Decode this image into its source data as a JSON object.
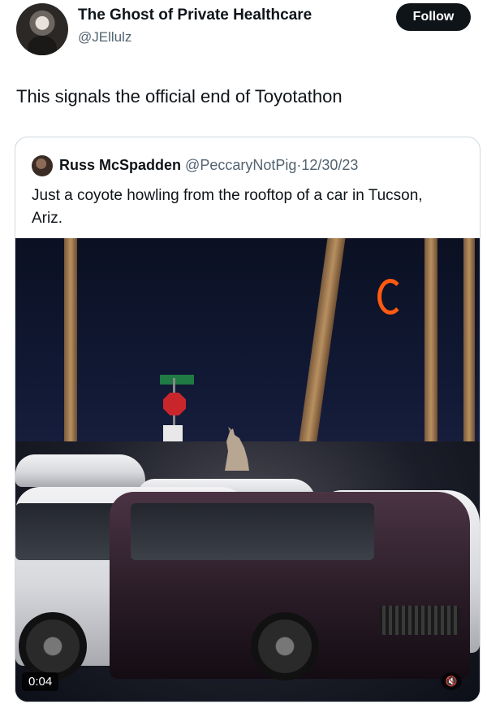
{
  "author": {
    "display_name": "The Ghost of Private Healthcare",
    "handle": "@JEllulz",
    "avatar_icon": "user-avatar-icon"
  },
  "follow_button": {
    "label": "Follow"
  },
  "tweet": {
    "text": "This signals the official end of Toyotathon"
  },
  "quoted_tweet": {
    "display_name": "Russ McSpadden",
    "handle": "@PeccaryNotPig",
    "separator": "·",
    "date": "12/30/23",
    "text": "Just a coyote howling from the rooftop of a car in Tucson, Ariz.",
    "media": {
      "timestamp": "0:04",
      "mute_icon": "speaker-muted-icon"
    }
  },
  "colors": {
    "follow_bg": "#0f1419",
    "secondary_text": "#536471",
    "border": "#cfd9de"
  }
}
